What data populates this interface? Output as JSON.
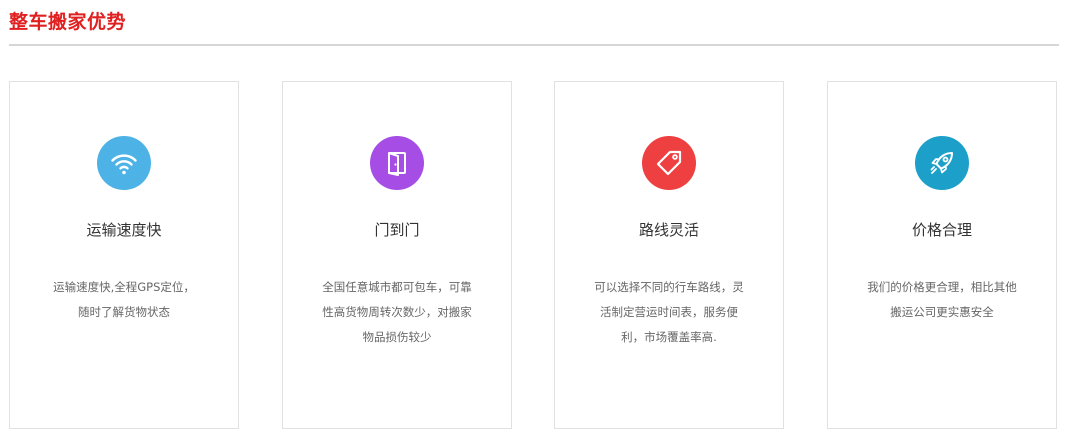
{
  "section": {
    "title": "整车搬家优势",
    "title_color": "#e02020"
  },
  "features": [
    {
      "icon": "wifi-icon",
      "icon_color": "#4db3e6",
      "title": "运输速度快",
      "desc_lines": [
        "运输速度快,全程GPS定位，",
        "随时了解货物状态"
      ]
    },
    {
      "icon": "door-icon",
      "icon_color": "#a64de6",
      "title": "门到门",
      "desc_lines": [
        "全国任意城市都可包车，可靠",
        "性高货物周转次数少，对搬家",
        "物品损伤较少"
      ]
    },
    {
      "icon": "tag-icon",
      "icon_color": "#ee4040",
      "title": "路线灵活",
      "desc_lines": [
        "可以选择不同的行车路线，灵",
        "活制定营运时间表，服务便",
        "利，市场覆盖率高."
      ]
    },
    {
      "icon": "rocket-icon",
      "icon_color": "#1ca0c9",
      "title": "价格合理",
      "desc_lines": [
        "我们的价格更合理，相比其他",
        "搬运公司更实惠安全"
      ]
    }
  ]
}
